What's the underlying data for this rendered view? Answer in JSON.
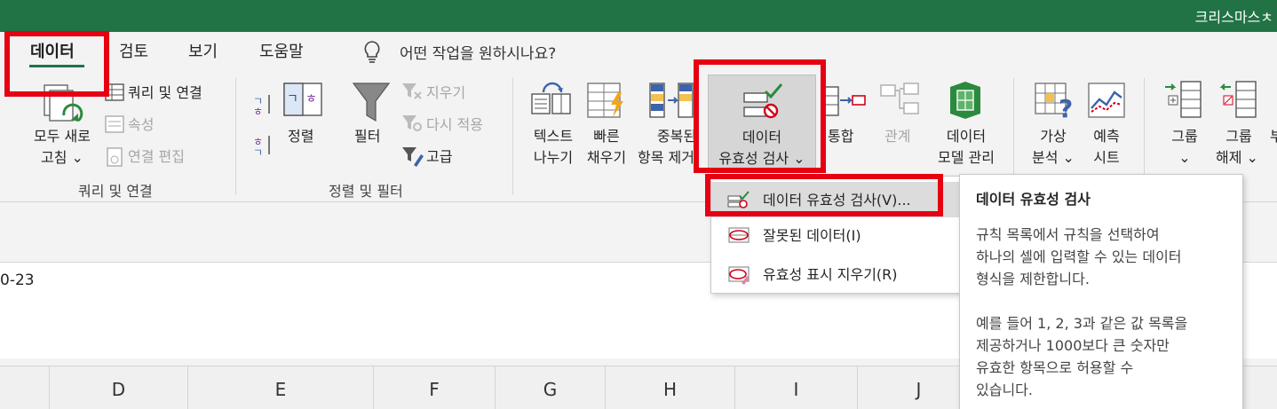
{
  "window": {
    "title": "크리스마스ㅊ"
  },
  "tabs": [
    {
      "label": "데이터",
      "active": true
    },
    {
      "label": "검토"
    },
    {
      "label": "보기"
    },
    {
      "label": "도움말"
    }
  ],
  "tell_me": "어떤 작업을 원하시나요?",
  "ribbon": {
    "get_data": {
      "refresh_all": [
        "모두 새로",
        "고침 ⌄"
      ],
      "queries_connections": "쿼리 및 연결",
      "properties": "속성",
      "edit_links": "연결 편집",
      "group_label": "쿼리 및 연결"
    },
    "sort_filter": {
      "sort": "정렬",
      "filter": "필터",
      "clear": "지우기",
      "reapply": "다시 적용",
      "advanced": "고급",
      "group_label": "정렬 및 필터"
    },
    "data_tools": {
      "text_to_columns": [
        "텍스트",
        "나누기"
      ],
      "flash_fill": [
        "빠른",
        "채우기"
      ],
      "remove_duplicates": [
        "중복된",
        "항목 제거"
      ],
      "data_validation": [
        "데이터",
        "유효성 검사 ⌄"
      ],
      "consolidate": "통합",
      "relationships": "관계",
      "data_model": [
        "데이터",
        "모델 관리"
      ]
    },
    "forecast": {
      "what_if": [
        "가상",
        "분석 ⌄"
      ],
      "forecast_sheet": [
        "예측",
        "시트"
      ]
    },
    "outline": {
      "group": [
        "그룹",
        "⌄"
      ],
      "ungroup": [
        "그룹",
        "해제 ⌄"
      ],
      "subtotal_partial": "부"
    }
  },
  "dropdown": {
    "items": [
      {
        "label": "데이터 유효성 검사(V)..."
      },
      {
        "label": "잘못된 데이터(I)"
      },
      {
        "label": "유효성 표시 지우기(R)"
      }
    ]
  },
  "tooltip": {
    "title": "데이터 유효성 검사",
    "lines": [
      "규칙 목록에서 규칙을 선택하여",
      "하나의 셀에 입력할 수 있는 데이터",
      "형식을 제한합니다.",
      "예를 들어 1, 2, 3과 같은 값 목록을",
      "제공하거나 1000보다 큰 숫자만",
      "유효한 항목으로 허용할 수",
      "있습니다."
    ]
  },
  "cell": {
    "value": "0-23"
  },
  "columns": [
    "D",
    "E",
    "F",
    "G",
    "H",
    "I",
    "J"
  ],
  "colors": {
    "brand": "#217346",
    "highlight": "#e60012"
  },
  "icons": [
    "lightbulb-icon",
    "refresh-icon",
    "sort-icon",
    "filter-icon",
    "check-validation-icon",
    "flash-fill-icon",
    "chart-icon"
  ]
}
